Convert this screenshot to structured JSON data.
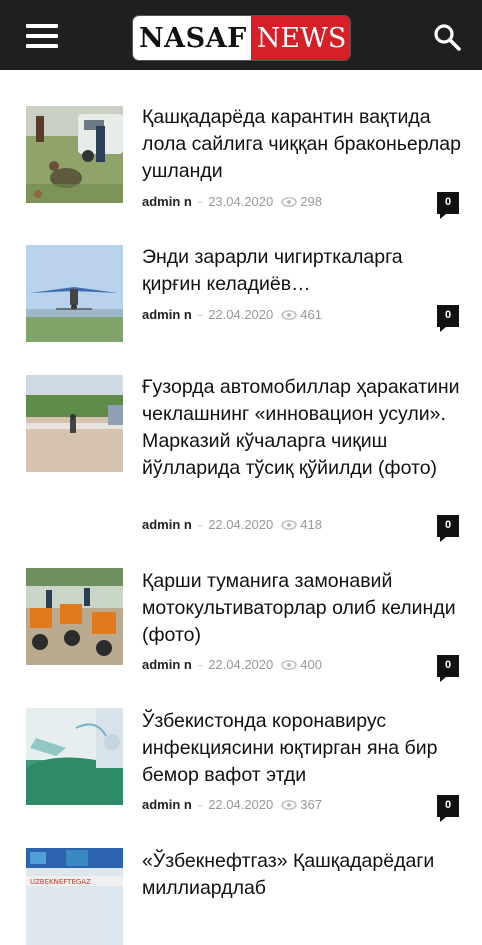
{
  "header": {
    "logo_left": "NASAF",
    "logo_right": "NEWS"
  },
  "articles": [
    {
      "title": "Қашқадарёда карантин вақтида лола сайлига чиққан браконьерлар ушланди",
      "author": "admin n",
      "date": "23.04.2020",
      "views": "298",
      "comments": "0"
    },
    {
      "title": "Энди зарарли чигирткаларга қирғин келадиёв…",
      "author": "admin n",
      "date": "22.04.2020",
      "views": "461",
      "comments": "0"
    },
    {
      "title": "Ғузорда автомобиллар ҳаракатини чеклашнинг «инновацион усули». Марказий кўчаларга чиқиш йўлларида тўсиқ қўйилди (фото)",
      "author": "admin n",
      "date": "22.04.2020",
      "views": "418",
      "comments": "0"
    },
    {
      "title": "Қарши туманига замонавий мотокультиваторлар олиб келинди (фото)",
      "author": "admin n",
      "date": "22.04.2020",
      "views": "400",
      "comments": "0"
    },
    {
      "title": "Ўзбекистонда коронавирус инфекциясини юқтирган яна бир бемор вафот этди",
      "author": "admin n",
      "date": "22.04.2020",
      "views": "367",
      "comments": "0"
    },
    {
      "title": "«Ўзбекнефтгаз» Қашқадарёдаги миллиардлаб",
      "author": "",
      "date": "",
      "views": "",
      "comments": ""
    }
  ],
  "thumb_sign": "UZBEKNEFTEGAZ"
}
